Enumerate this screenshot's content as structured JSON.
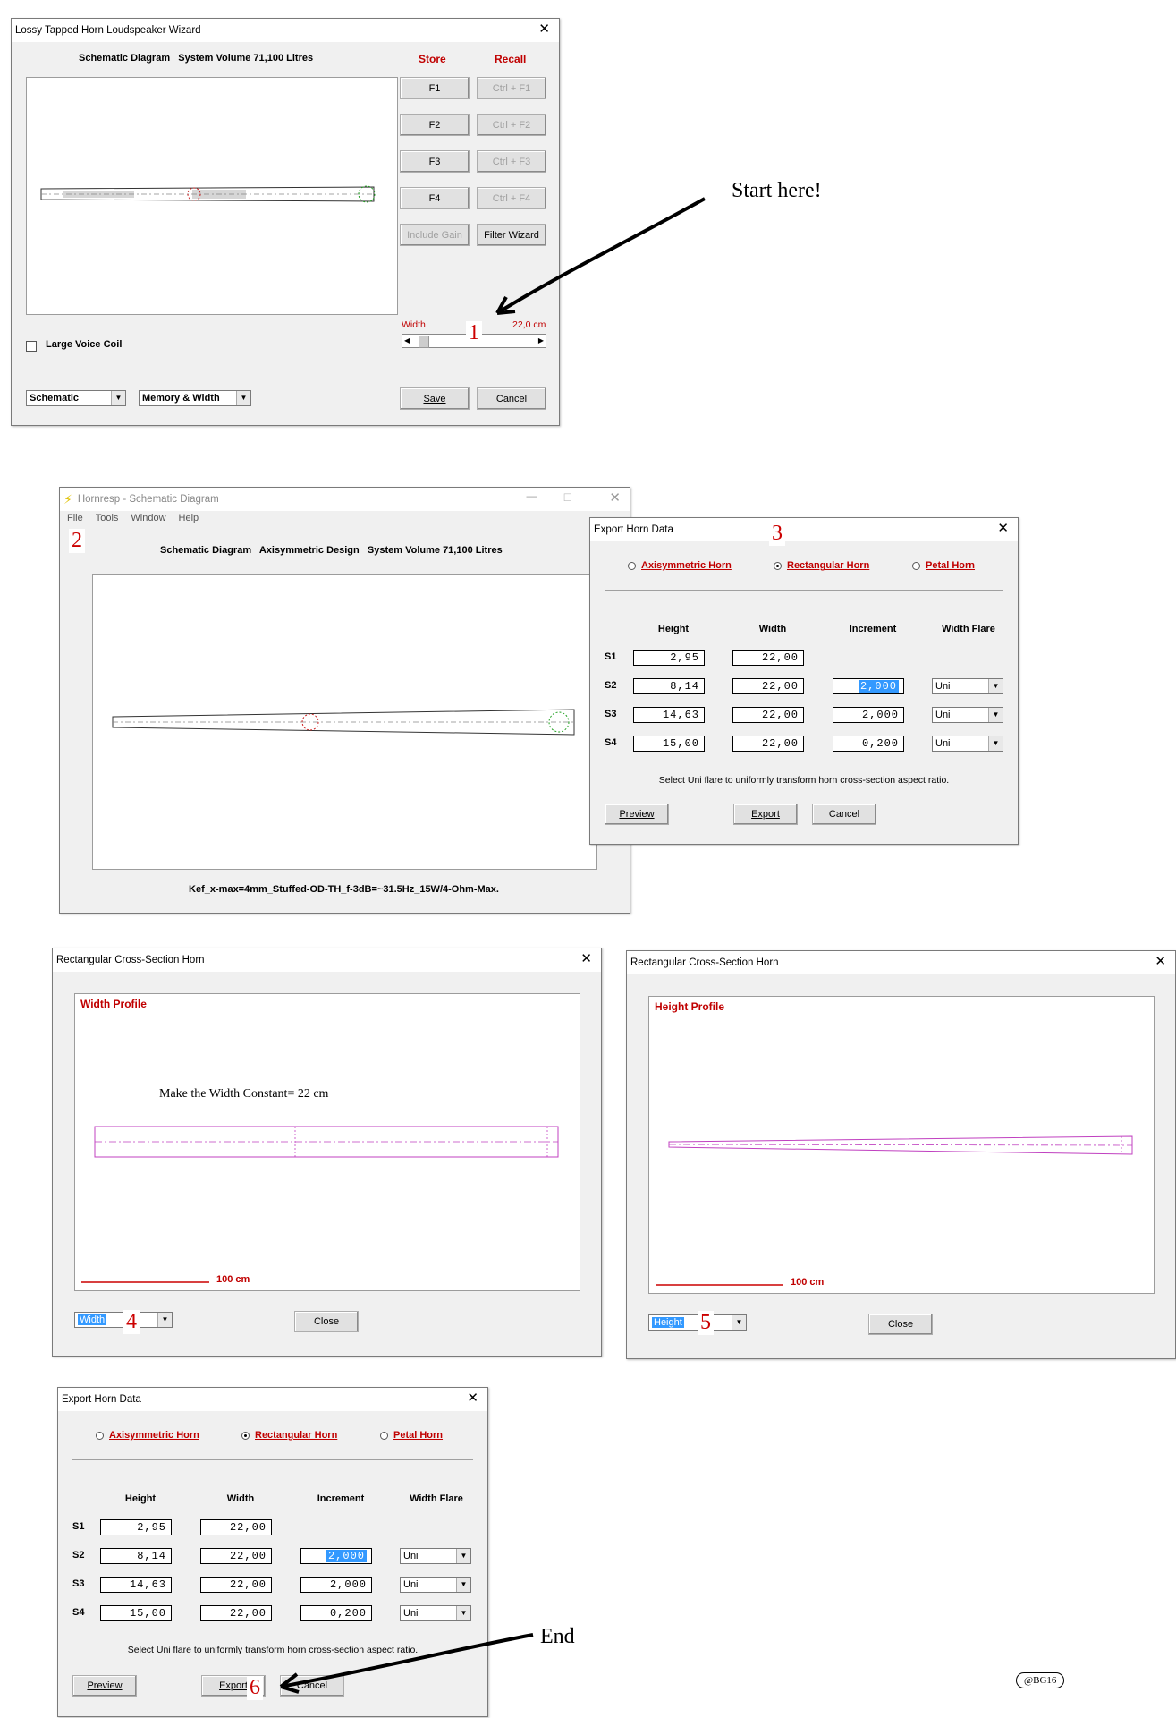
{
  "win1": {
    "title": "Lossy Tapped Horn Loudspeaker Wizard",
    "header": "Schematic Diagram   System Volume 71,100 Litres",
    "store_label": "Store",
    "recall_label": "Recall",
    "store_buttons": [
      "F1",
      "F2",
      "F3",
      "F4"
    ],
    "recall_buttons": [
      "Ctrl + F1",
      "Ctrl + F2",
      "Ctrl + F3",
      "Ctrl + F4"
    ],
    "include_gain": "Include Gain",
    "filter_wizard": "Filter Wizard",
    "width_label": "Width",
    "width_value": "22,0 cm",
    "large_voice_coil": "Large Voice Coil",
    "combo_view": "Schematic",
    "combo_mode": "Memory & Width",
    "save": "Save",
    "cancel": "Cancel",
    "step": "1"
  },
  "start_here": "Start here!",
  "win2": {
    "title": "Hornresp - Schematic Diagram",
    "menu": [
      "File",
      "Tools",
      "Window",
      "Help"
    ],
    "header": "Schematic Diagram   Axisymmetric Design   System Volume 71,100 Litres",
    "footer": "Kef_x-max=4mm_Stuffed-OD-TH_f-3dB=~31.5Hz_15W/4-Ohm-Max.",
    "step": "2"
  },
  "export": {
    "title": "Export Horn Data",
    "radio_axisymmetric": "Axisymmetric Horn",
    "radio_rectangular": "Rectangular Horn",
    "radio_petal": "Petal Horn",
    "col_height": "Height",
    "col_width": "Width",
    "col_increment": "Increment",
    "col_width_flare": "Width Flare",
    "rows": [
      {
        "label": "S1",
        "height": "2,95",
        "width": "22,00",
        "increment": "",
        "flare": ""
      },
      {
        "label": "S2",
        "height": "8,14",
        "width": "22,00",
        "increment": "2,000",
        "flare": "Uni"
      },
      {
        "label": "S3",
        "height": "14,63",
        "width": "22,00",
        "increment": "2,000",
        "flare": "Uni"
      },
      {
        "label": "S4",
        "height": "15,00",
        "width": "22,00",
        "increment": "0,200",
        "flare": "Uni"
      }
    ],
    "hint": "Select Uni flare to uniformly transform horn cross-section aspect ratio.",
    "preview": "Preview",
    "export_btn": "Export",
    "cancel": "Cancel",
    "step3": "3",
    "step6": "6"
  },
  "win4": {
    "title": "Rectangular Cross-Section Horn",
    "profile_label": "Width Profile",
    "annotation": "Make the Width Constant= 22 cm",
    "scale": "100 cm",
    "combo": "Width",
    "close": "Close",
    "step": "4"
  },
  "win5": {
    "title": "Rectangular Cross-Section Horn",
    "profile_label": "Height Profile",
    "scale": "100 cm",
    "combo": "Height",
    "close": "Close",
    "step": "5"
  },
  "end_label": "End",
  "watermark": "@BG16",
  "colors": {
    "accent_red": "#c00000",
    "magenta": "#c040c0",
    "selection": "#3399ff"
  }
}
